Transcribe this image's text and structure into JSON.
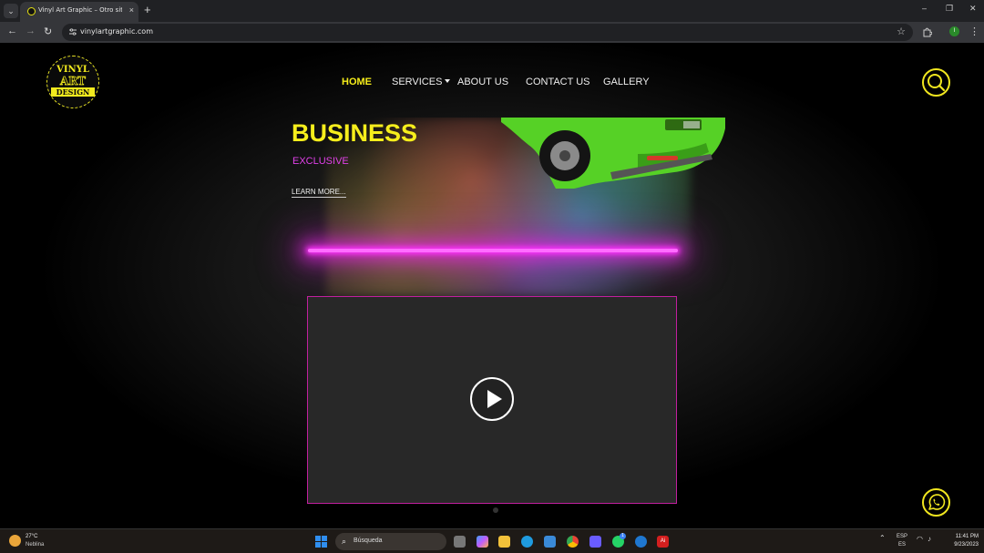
{
  "browser": {
    "tab_title": "Vinyl Art Graphic – Otro sitio n...",
    "tab_close": "×",
    "new_tab": "+",
    "tab_list": "⌄",
    "minimize": "–",
    "restore": "❐",
    "close": "✕",
    "back": "←",
    "forward": "→",
    "reload": "↻",
    "url": "vinylartgraphic.com",
    "bookmark": "☆",
    "profile_initial": "I",
    "menu": "⋮"
  },
  "site": {
    "logo": {
      "line1": "VINYL",
      "line2": "ART",
      "line3": "DESIGN"
    },
    "nav": {
      "home": "HOME",
      "services": "SERVICES",
      "about": "ABOUT US",
      "contact": "CONTACT US",
      "gallery": "GALLERY"
    },
    "hero": {
      "title": "BUSINESS",
      "subtitle": "EXCLUSIVE",
      "cta": "LEARN MORE..."
    }
  },
  "taskbar": {
    "weather_temp": "27°C",
    "weather_condition": "Neblina",
    "search_placeholder": "Búsqueda",
    "lang_top": "ESP",
    "lang_bottom": "ES",
    "time": "11:41 PM",
    "date": "9/23/2023",
    "whatsapp_badge": "1"
  },
  "colors": {
    "accent_yellow": "#f5ec1a",
    "accent_magenta": "#e040e8",
    "neon": "#ff33ff",
    "video_border": "#c21f9f"
  }
}
